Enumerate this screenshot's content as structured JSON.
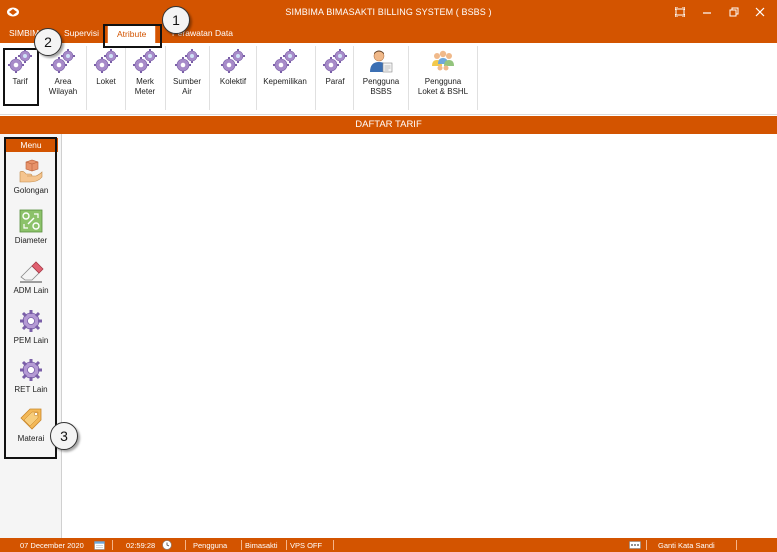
{
  "window": {
    "title": "SIMBIMA BIMASAKTI BILLING SYSTEM ( BSBS )"
  },
  "menu_tabs": [
    {
      "label": "SIMBIMA"
    },
    {
      "label": "Supervisi"
    },
    {
      "label": "Atribute"
    },
    {
      "label": "Perawatan Data"
    }
  ],
  "ribbon": {
    "buttons": [
      {
        "label": "Tarif",
        "icon": "gears-icon"
      },
      {
        "label": "Area\nWilayah",
        "icon": "gears-icon"
      },
      {
        "label": "Loket",
        "icon": "gears-icon"
      },
      {
        "label": "Merk\nMeter",
        "icon": "gears-icon"
      },
      {
        "label": "Sumber\nAir",
        "icon": "gears-icon"
      },
      {
        "label": "Kolektif",
        "icon": "gears-icon"
      },
      {
        "label": "Kepemilikan",
        "icon": "gears-icon"
      },
      {
        "label": "Paraf",
        "icon": "gears-icon"
      },
      {
        "label": "Pengguna\nBSBS",
        "icon": "user-icon"
      },
      {
        "label": "Pengguna\nLoket & BSHL",
        "icon": "users-group-icon"
      }
    ]
  },
  "section": {
    "title": "DAFTAR TARIF"
  },
  "left_menu": {
    "header": "Menu",
    "items": [
      {
        "label": "Golongan",
        "icon": "box-hand-icon"
      },
      {
        "label": "Diameter",
        "icon": "diameter-icon"
      },
      {
        "label": "ADM Lain",
        "icon": "eraser-icon"
      },
      {
        "label": "PEM Lain",
        "icon": "gear-icon"
      },
      {
        "label": "RET Lain",
        "icon": "gear-icon"
      },
      {
        "label": "Materai",
        "icon": "tag-icon"
      }
    ]
  },
  "callouts": [
    "1",
    "2",
    "3"
  ],
  "status": {
    "date": "07 December 2020",
    "time": "02:59:28",
    "user_label": "Pengguna",
    "user_name": "Bimasakti",
    "vps": "VPS OFF",
    "change_password": "Ganti Kata Sandi"
  },
  "colors": {
    "accent": "#d35400"
  }
}
